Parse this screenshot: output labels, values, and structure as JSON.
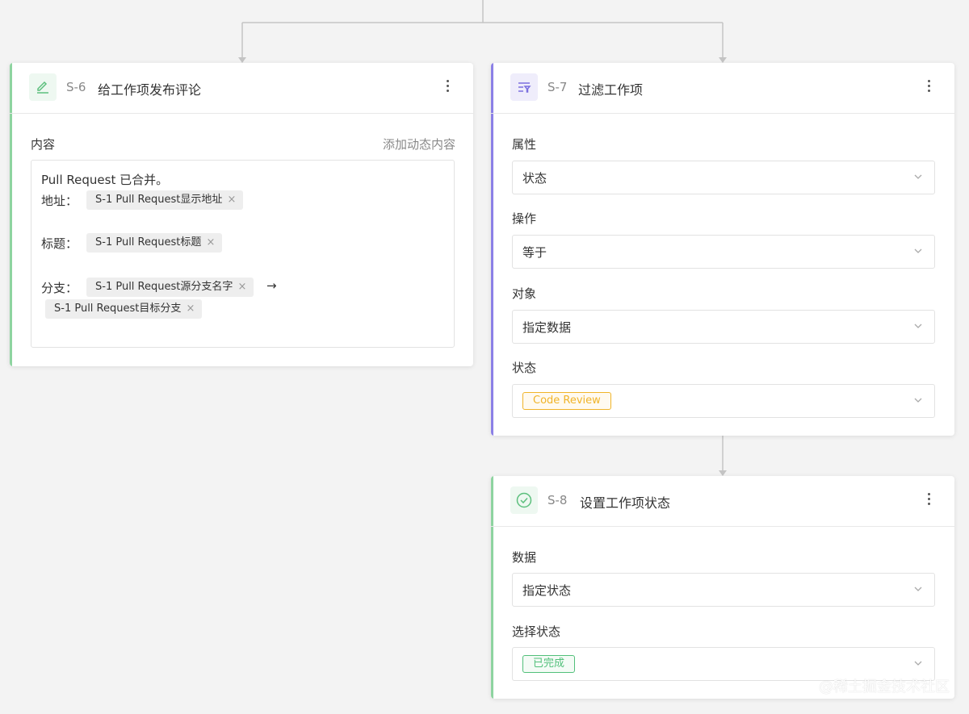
{
  "colors": {
    "green_accent": "#8ed4a0",
    "purple_accent": "#8b80e6",
    "tag_warning": "#f0b429",
    "tag_success": "#52c07a"
  },
  "card_s6": {
    "icon": "edit-pencil-icon",
    "step_id": "S-6",
    "title": "给工作项发布评论",
    "content_label": "内容",
    "add_dynamic_link": "添加动态内容",
    "editor": {
      "line1": "Pull Request 已合并。",
      "address_label": "地址：",
      "address_chip": "S-1 Pull Request显示地址",
      "title_label": "标题：",
      "title_chip": "S-1 Pull Request标题",
      "branch_label": "分支：",
      "branch_source_chip": "S-1 Pull Request源分支名字",
      "arrow": "→",
      "branch_target_chip": "S-1 Pull Request目标分支",
      "chip_remove": "×"
    }
  },
  "card_s7": {
    "icon": "filter-icon",
    "step_id": "S-7",
    "title": "过滤工作项",
    "fields": [
      {
        "label": "属性",
        "value": "状态"
      },
      {
        "label": "操作",
        "value": "等于"
      },
      {
        "label": "对象",
        "value": "指定数据"
      },
      {
        "label": "状态",
        "tag": "Code Review"
      }
    ]
  },
  "card_s8": {
    "icon": "check-circle-icon",
    "step_id": "S-8",
    "title": "设置工作项状态",
    "fields": [
      {
        "label": "数据",
        "value": "指定状态"
      },
      {
        "label": "选择状态",
        "tag": "已完成"
      }
    ]
  },
  "watermark": "@稀土掘金技术社区"
}
